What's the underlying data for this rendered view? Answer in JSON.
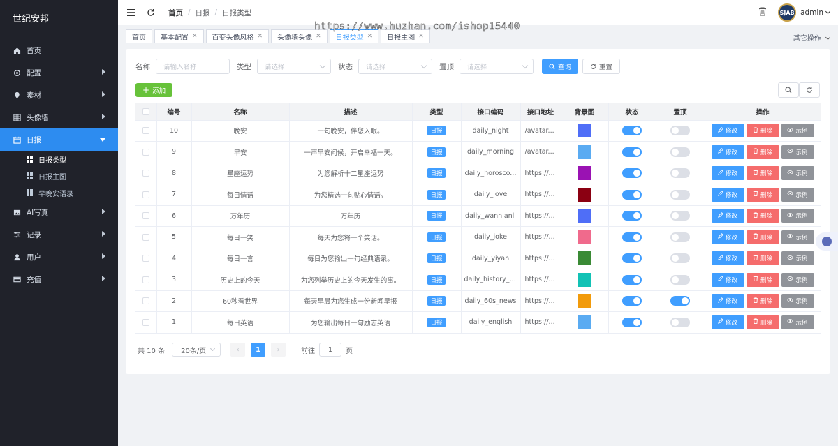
{
  "sidebar": {
    "brand": "世纪安邦",
    "items": [
      {
        "label": "首页",
        "icon": "home-icon"
      },
      {
        "label": "配置",
        "icon": "gear-icon"
      },
      {
        "label": "素材",
        "icon": "pin-icon"
      },
      {
        "label": "头像墙",
        "icon": "grid-icon"
      },
      {
        "label": "日报",
        "icon": "calendar-icon"
      },
      {
        "label": "AI写真",
        "icon": "image-icon"
      },
      {
        "label": "记录",
        "icon": "sliders-icon"
      },
      {
        "label": "用户",
        "icon": "user-icon"
      },
      {
        "label": "充值",
        "icon": "card-icon"
      }
    ],
    "sub_items": [
      {
        "label": "日报类型"
      },
      {
        "label": "日报主图"
      },
      {
        "label": "早晚安语录"
      }
    ]
  },
  "topbar": {
    "breadcrumb": [
      "首页",
      "日报",
      "日报类型"
    ],
    "user": "admin",
    "avatar_text": "SJAB"
  },
  "watermark": "https://www.huzhan.com/ishop15440",
  "tabs": [
    {
      "label": "首页",
      "closable": false
    },
    {
      "label": "基本配置",
      "closable": true
    },
    {
      "label": "百变头像风格",
      "closable": true
    },
    {
      "label": "头像墙头像",
      "closable": true
    },
    {
      "label": "日报类型",
      "closable": true
    },
    {
      "label": "日报主图",
      "closable": true
    }
  ],
  "other_ops": "其它操作",
  "filters": {
    "name_label": "名称",
    "name_placeholder": "请输入名称",
    "type_label": "类型",
    "type_placeholder": "请选择",
    "status_label": "状态",
    "status_placeholder": "请选择",
    "top_label": "置顶",
    "top_placeholder": "请选择",
    "search_btn": "查询",
    "reset_btn": "重置"
  },
  "add_btn": "添加",
  "table": {
    "headers": [
      "编号",
      "名称",
      "描述",
      "类型",
      "接口编码",
      "接口地址",
      "背景图",
      "状态",
      "置顶",
      "操作"
    ],
    "edit_label": "修改",
    "delete_label": "删除",
    "view_label": "示例",
    "rows": [
      {
        "id": "10",
        "name": "晚安",
        "desc": "一句晚安，伴您入眠。",
        "type": "日报",
        "code": "daily_night",
        "url": "/avatar...",
        "color": "#4f6ef7",
        "status": true,
        "top": false
      },
      {
        "id": "9",
        "name": "早安",
        "desc": "一声早安问候，开启幸福一天。",
        "type": "日报",
        "code": "daily_morning",
        "url": "/avatar...",
        "color": "#5aabf2",
        "status": true,
        "top": false
      },
      {
        "id": "8",
        "name": "星座运势",
        "desc": "为您解析十二星座运势",
        "type": "日报",
        "code": "daily_horosco...",
        "url": "https://...",
        "color": "#9a12b3",
        "status": true,
        "top": false
      },
      {
        "id": "7",
        "name": "每日情话",
        "desc": "为您精选一句贴心情话。",
        "type": "日报",
        "code": "daily_love",
        "url": "https://...",
        "color": "#8b0012",
        "status": true,
        "top": false
      },
      {
        "id": "6",
        "name": "万年历",
        "desc": "万年历",
        "type": "日报",
        "code": "daily_wannianli",
        "url": "https://...",
        "color": "#4f6ef7",
        "status": true,
        "top": false
      },
      {
        "id": "5",
        "name": "每日一笑",
        "desc": "每天为您将一个笑话。",
        "type": "日报",
        "code": "daily_joke",
        "url": "https://...",
        "color": "#f06a8c",
        "status": true,
        "top": false
      },
      {
        "id": "4",
        "name": "每日一言",
        "desc": "每日为您输出一句经典语录。",
        "type": "日报",
        "code": "daily_yiyan",
        "url": "https://...",
        "color": "#3a8a35",
        "status": true,
        "top": false
      },
      {
        "id": "3",
        "name": "历史上的今天",
        "desc": "为您列举历史上的今天发生的事。",
        "type": "日报",
        "code": "daily_history_t...",
        "url": "https://...",
        "color": "#12c2b5",
        "status": true,
        "top": false
      },
      {
        "id": "2",
        "name": "60秒看世界",
        "desc": "每天早晨为您生成一份新闻早报",
        "type": "日报",
        "code": "daily_60s_news",
        "url": "https://...",
        "color": "#f29b0c",
        "status": true,
        "top": true
      },
      {
        "id": "1",
        "name": "每日英语",
        "desc": "为您输出每日一句励志英语",
        "type": "日报",
        "code": "daily_english",
        "url": "https://...",
        "color": "#5aabf2",
        "status": true,
        "top": false
      }
    ]
  },
  "pager": {
    "total": "共 10 条",
    "page_size": "20条/页",
    "prev": "‹",
    "current": "1",
    "next": "›",
    "goto_label": "前往",
    "goto_value": "1",
    "page_suffix": "页"
  }
}
